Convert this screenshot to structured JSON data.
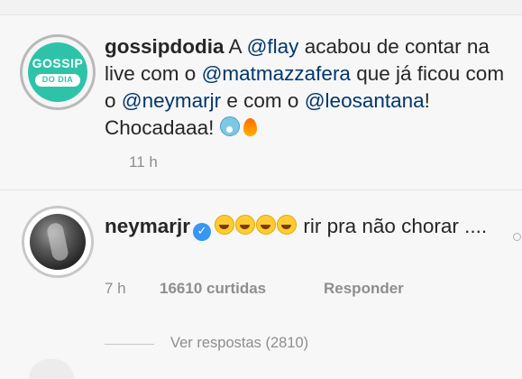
{
  "comment1": {
    "username": "gossipdodia",
    "avatar_text": {
      "line1": "GOSSIP",
      "line2": "DO DIA"
    },
    "text": {
      "p1": "A",
      "m1": "@flay",
      "p2": "acabou de contar na live com o",
      "m2": "@matmazzafera",
      "p3": "que já ficou com o",
      "m3": "@neymarjr",
      "p4": "e com o",
      "m4": "@leosantana",
      "p5": "! Chocadaaa!"
    },
    "emojis": [
      "face-screaming-emoji",
      "fire-emoji"
    ],
    "time": "11 h"
  },
  "comment2": {
    "username": "neymarjr",
    "verified": true,
    "emojis": [
      "rofl-emoji",
      "joy-emoji",
      "rofl-emoji",
      "joy-emoji"
    ],
    "text": "rir pra não chorar ....",
    "time": "7 h",
    "likes": "16610 curtidas",
    "reply_label": "Responder"
  },
  "view_replies": "Ver respostas (2810)",
  "colors": {
    "mention": "#00376b",
    "meta": "#8e8e8e",
    "verified": "#3897f0",
    "brand": "#2ec3a9"
  }
}
